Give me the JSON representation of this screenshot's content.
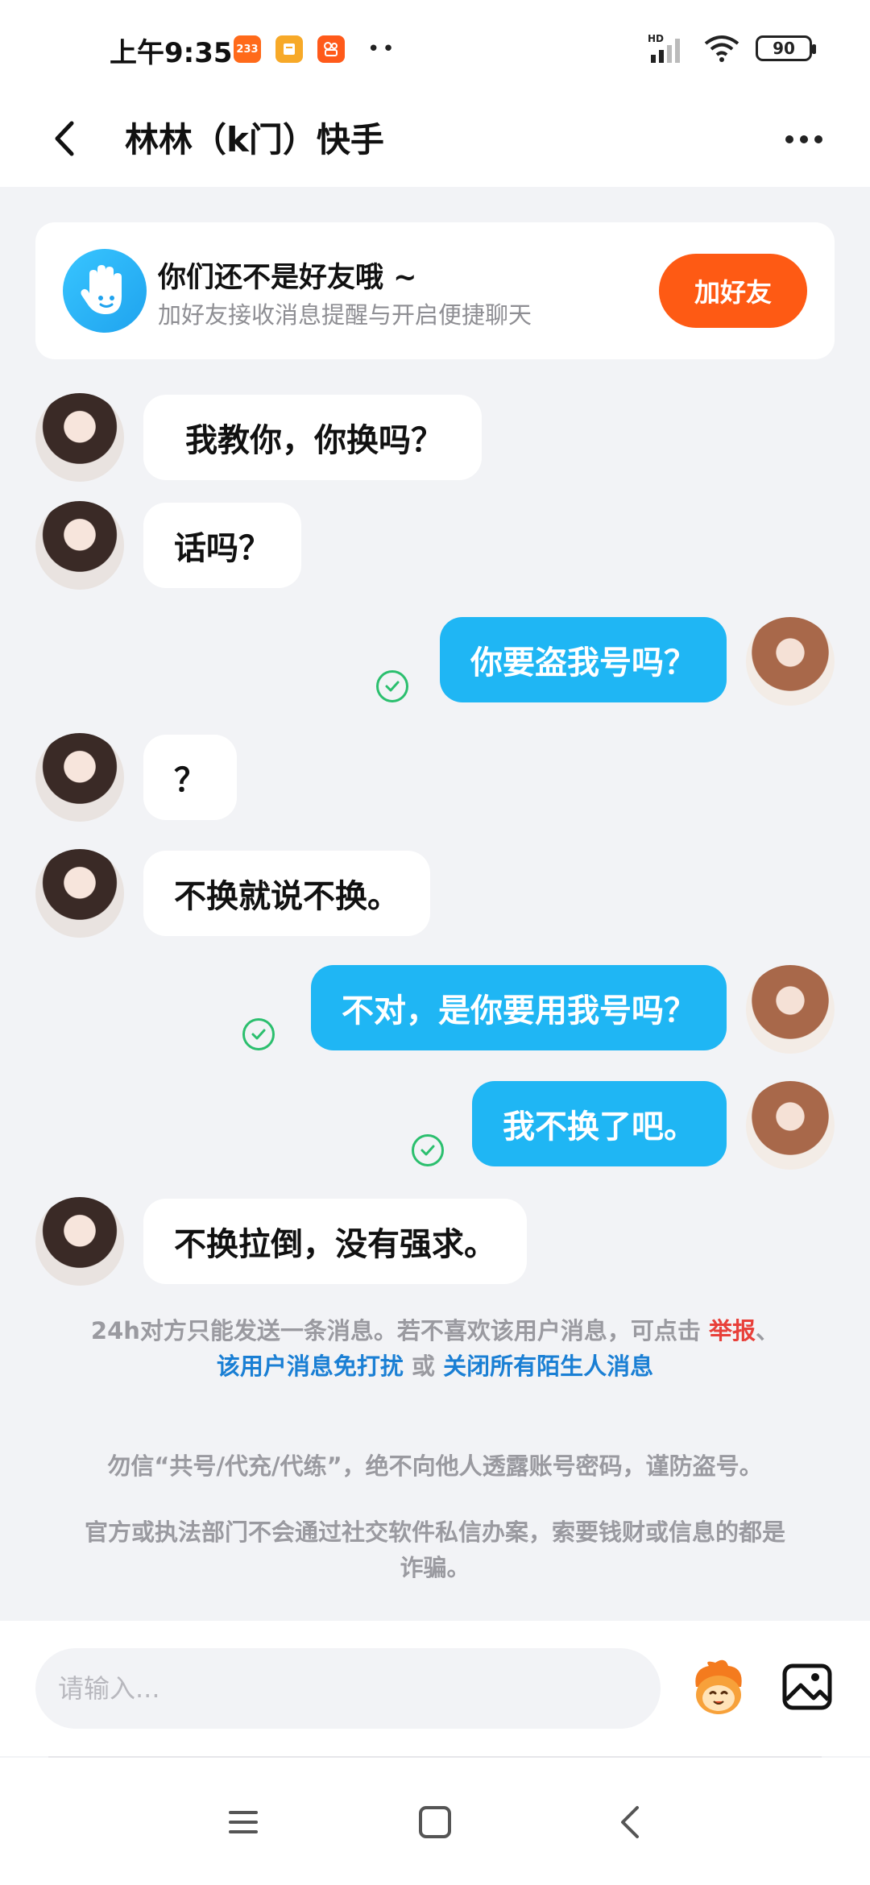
{
  "status_bar": {
    "time": "上午9:35",
    "app_badge_1": "233",
    "battery": "90",
    "hd_label": "HD"
  },
  "header": {
    "title": "林林（k门）快手"
  },
  "friend_card": {
    "title": "你们还不是好友哦 ~",
    "subtitle": "加好友接收消息提醒与开启便捷聊天",
    "button_label": "加好友"
  },
  "messages": [
    {
      "side": "in",
      "text": "我教你，你换吗？"
    },
    {
      "side": "in",
      "text": "话吗？"
    },
    {
      "side": "out",
      "text": "你要盗我号吗？",
      "read": true
    },
    {
      "side": "in",
      "text": "？"
    },
    {
      "side": "in",
      "text": "不换就说不换。"
    },
    {
      "side": "out",
      "text": "不对，是你要用我号吗？",
      "read": true
    },
    {
      "side": "out",
      "text": "我不换了吧。",
      "read": true
    },
    {
      "side": "in",
      "text": "不换拉倒，没有强求。"
    }
  ],
  "notice": {
    "prefix": "24h对方只能发送一条消息。若不喜欢该用户消息，可点击 ",
    "report": "举报",
    "sep": "、",
    "mute": "该用户消息免打扰",
    "or": " 或 ",
    "close_all": "关闭所有陌生人消息"
  },
  "tips": {
    "tip1": "勿信“共号/代充/代练”，绝不向他人透露账号密码，谨防盗号。",
    "tip2": "官方或执法部门不会通过社交软件私信办案，索要钱财或信息的都是诈骗。"
  },
  "input": {
    "placeholder": "请输入..."
  },
  "colors": {
    "accent_orange": "#fe5a14",
    "bubble_blue": "#1fb6f4",
    "read_green": "#2bbf6e",
    "link_blue": "#1a7fd4",
    "report_red": "#e8403a"
  },
  "icons": {
    "back": "back-arrow-icon",
    "more": "more-icon",
    "friend": "hand-icon",
    "emoji": "emoji-icon",
    "image": "image-icon",
    "read": "check-circle-icon"
  }
}
